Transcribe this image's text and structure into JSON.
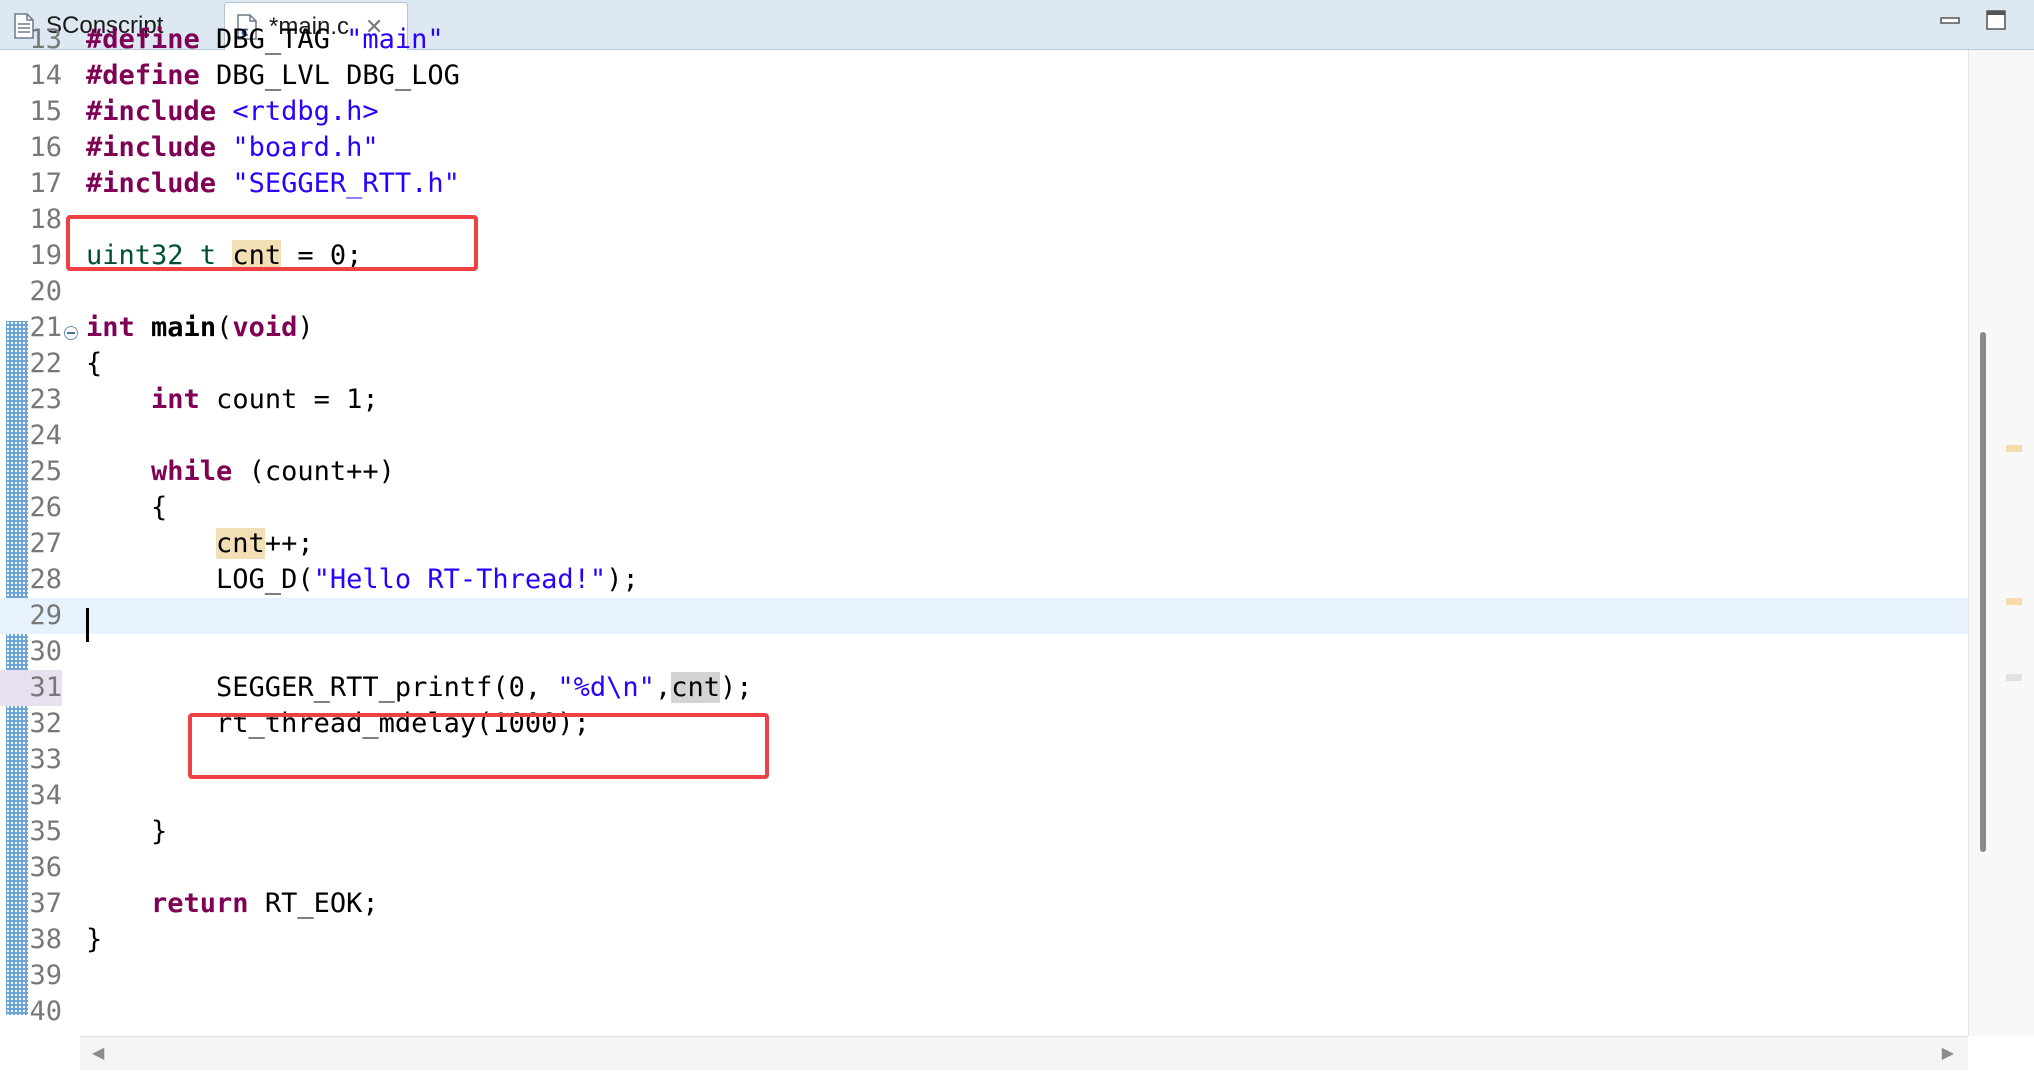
{
  "tabs": [
    {
      "label": "SConscript",
      "icon": "text-file-icon",
      "active": false
    },
    {
      "label": "*main.c",
      "icon": "c-source-file-icon",
      "active": true
    }
  ],
  "window_controls": [
    "minimize-icon",
    "maximize-icon"
  ],
  "colors": {
    "keyword": "#7f0055",
    "string": "#2a00ff",
    "type": "#005032",
    "occurrence_highlight": "#f3dfb6",
    "current_line": "#e8f2fe",
    "annotation_box": "#ef4145"
  },
  "editor": {
    "current_line": 29,
    "lines": [
      {
        "n": "13",
        "tokens": [
          {
            "t": "#define",
            "c": "kw"
          },
          {
            "t": " DBG_TAG "
          },
          {
            "t": "\"main\"",
            "c": "str"
          }
        ]
      },
      {
        "n": "14",
        "tokens": [
          {
            "t": "#define",
            "c": "kw"
          },
          {
            "t": " DBG_LVL DBG_LOG"
          }
        ]
      },
      {
        "n": "15",
        "tokens": [
          {
            "t": "#include",
            "c": "kw"
          },
          {
            "t": " "
          },
          {
            "t": "<rtdbg.h>",
            "c": "str"
          }
        ]
      },
      {
        "n": "16",
        "tokens": [
          {
            "t": "#include",
            "c": "kw"
          },
          {
            "t": " "
          },
          {
            "t": "\"board.h\"",
            "c": "str"
          }
        ]
      },
      {
        "n": "17",
        "tokens": [
          {
            "t": "#include",
            "c": "kw"
          },
          {
            "t": " "
          },
          {
            "t": "\"SEGGER_RTT.h\"",
            "c": "str"
          }
        ]
      },
      {
        "n": "18",
        "tokens": []
      },
      {
        "n": "19",
        "tokens": [
          {
            "t": "uint32_t",
            "c": "typ"
          },
          {
            "t": " "
          },
          {
            "t": "cnt",
            "c": "occ"
          },
          {
            "t": " = 0;"
          }
        ]
      },
      {
        "n": "20",
        "tokens": []
      },
      {
        "n": "21",
        "tokens": [
          {
            "t": "int",
            "c": "kw"
          },
          {
            "t": " "
          },
          {
            "t": "main",
            "c": "bold"
          },
          {
            "t": "("
          },
          {
            "t": "void",
            "c": "kw"
          },
          {
            "t": ")"
          }
        ]
      },
      {
        "n": "22",
        "tokens": [
          {
            "t": "{"
          }
        ]
      },
      {
        "n": "23",
        "tokens": [
          {
            "t": "    "
          },
          {
            "t": "int",
            "c": "kw"
          },
          {
            "t": " count = 1;"
          }
        ]
      },
      {
        "n": "24",
        "tokens": []
      },
      {
        "n": "25",
        "tokens": [
          {
            "t": "    "
          },
          {
            "t": "while",
            "c": "kw"
          },
          {
            "t": " (count++)"
          }
        ]
      },
      {
        "n": "26",
        "tokens": [
          {
            "t": "    {"
          }
        ]
      },
      {
        "n": "27",
        "tokens": [
          {
            "t": "        "
          },
          {
            "t": "cnt",
            "c": "occ"
          },
          {
            "t": "++;"
          }
        ]
      },
      {
        "n": "28",
        "tokens": [
          {
            "t": "        LOG_D("
          },
          {
            "t": "\"Hello RT-Thread!\"",
            "c": "str"
          },
          {
            "t": ");"
          }
        ]
      },
      {
        "n": "29",
        "tokens": []
      },
      {
        "n": "30",
        "tokens": []
      },
      {
        "n": "31",
        "tokens": [
          {
            "t": "        SEGGER_RTT_printf(0, "
          },
          {
            "t": "\"%d\\n\"",
            "c": "str"
          },
          {
            "t": ","
          },
          {
            "t": "cnt",
            "c": "occ2"
          },
          {
            "t": ");"
          }
        ]
      },
      {
        "n": "32",
        "tokens": [
          {
            "t": "        rt_thread_mdelay(1000);"
          }
        ]
      },
      {
        "n": "33",
        "tokens": []
      },
      {
        "n": "34",
        "tokens": []
      },
      {
        "n": "35",
        "tokens": [
          {
            "t": "    }"
          }
        ]
      },
      {
        "n": "36",
        "tokens": []
      },
      {
        "n": "37",
        "tokens": [
          {
            "t": "    "
          },
          {
            "t": "return",
            "c": "kw"
          },
          {
            "t": " RT_EOK;"
          }
        ]
      },
      {
        "n": "38",
        "tokens": [
          {
            "t": "}"
          }
        ]
      },
      {
        "n": "39",
        "tokens": []
      },
      {
        "n": "40",
        "tokens": []
      }
    ]
  }
}
